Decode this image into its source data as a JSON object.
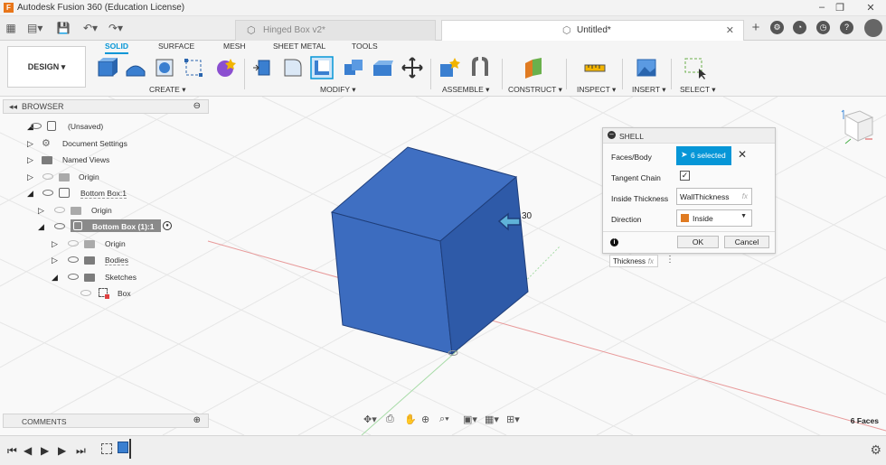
{
  "window": {
    "title": "Autodesk Fusion 360 (Education License)",
    "logo_letter": "F"
  },
  "tabs": [
    {
      "label": "Hinged Box v2*",
      "active": false
    },
    {
      "label": "Untitled*",
      "active": true
    }
  ],
  "ribbon": {
    "workspace_button": "DESIGN ▾",
    "workspace_tabs": [
      "SOLID",
      "SURFACE",
      "MESH",
      "SHEET METAL",
      "TOOLS"
    ],
    "active_tab": "SOLID",
    "groups": [
      "CREATE ▾",
      "MODIFY ▾",
      "ASSEMBLE ▾",
      "CONSTRUCT ▾",
      "INSPECT ▾",
      "INSERT ▾",
      "SELECT ▾"
    ]
  },
  "browser": {
    "header": "BROWSER",
    "items": [
      {
        "label": "(Unsaved)"
      },
      {
        "label": "Document Settings"
      },
      {
        "label": "Named Views"
      },
      {
        "label": "Origin"
      },
      {
        "label": "Bottom Box:1"
      },
      {
        "label": "Origin"
      },
      {
        "label": "Bottom Box (1):1"
      },
      {
        "label": "Origin"
      },
      {
        "label": "Bodies"
      },
      {
        "label": "Sketches"
      },
      {
        "label": "Box"
      }
    ]
  },
  "shell_dialog": {
    "title": "SHELL",
    "faces_label": "Faces/Body",
    "faces_value": "6 selected",
    "tangent_label": "Tangent Chain",
    "tangent_checked": true,
    "thickness_label": "Inside Thickness",
    "thickness_value": "WallThickness",
    "direction_label": "Direction",
    "direction_value": "Inside",
    "ok_label": "OK",
    "cancel_label": "Cancel",
    "fx_label": "fx"
  },
  "viewport": {
    "dimension_fragment": "30",
    "chip_text": "Thickness",
    "cube_color": "#3a64b4"
  },
  "comments": {
    "header": "COMMENTS"
  },
  "status": {
    "selection_count": "6 Faces"
  }
}
